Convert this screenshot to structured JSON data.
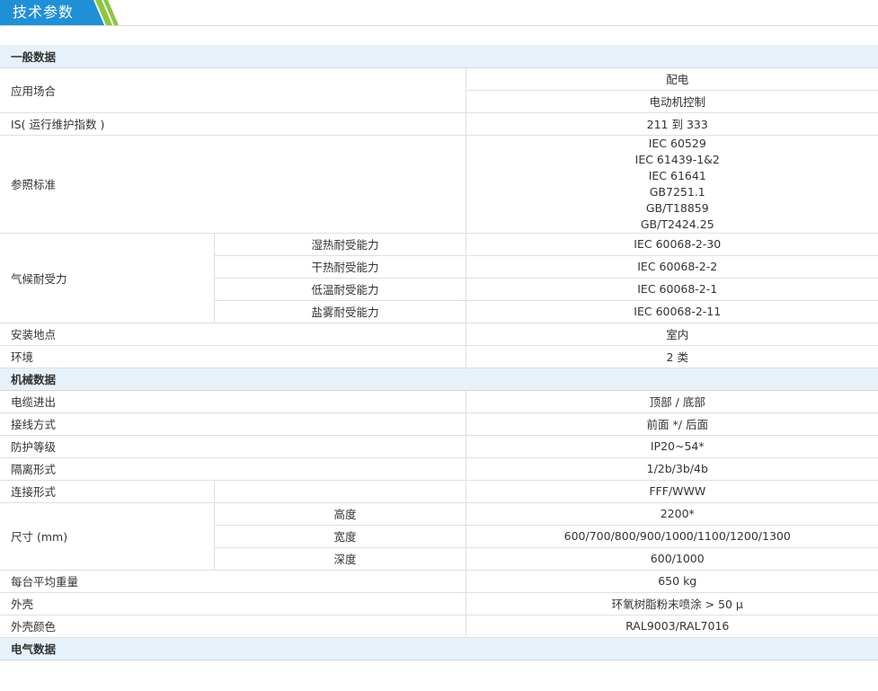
{
  "header": {
    "tab_title": "技术参数",
    "tab_color": "#1f8fd6",
    "stripe_color": "#8dc63f"
  },
  "sections": {
    "general": "一般数据",
    "mechanical": "机械数据",
    "electrical": "电气数据"
  },
  "rows": {
    "application": {
      "label": "应用场合",
      "values": [
        "配电",
        "电动机控制"
      ]
    },
    "is": {
      "label": "IS( 运行维护指数 )",
      "value": "211 到 333"
    },
    "standards": {
      "label": "参照标准",
      "values": [
        "IEC 60529",
        "IEC 61439-1&2",
        "IEC 61641",
        "GB7251.1",
        "GB/T18859",
        "GB/T2424.25"
      ]
    },
    "climate": {
      "label": "气候耐受力",
      "items": [
        {
          "name": "湿热耐受能力",
          "value": "IEC 60068-2-30"
        },
        {
          "name": "干热耐受能力",
          "value": "IEC 60068-2-2"
        },
        {
          "name": "低温耐受能力",
          "value": "IEC 60068-2-1"
        },
        {
          "name": "盐雾耐受能力",
          "value": "IEC 60068-2-11"
        }
      ]
    },
    "location": {
      "label": "安装地点",
      "value": "室内"
    },
    "environment": {
      "label": "环境",
      "value": "2 类"
    },
    "cable": {
      "label": "电缆进出",
      "value": "顶部 / 底部"
    },
    "wiring": {
      "label": "接线方式",
      "value": "前面 */ 后面"
    },
    "protection": {
      "label": "防护等级",
      "value": "IP20~54*"
    },
    "separation": {
      "label": "隔离形式",
      "value": "1/2b/3b/4b"
    },
    "connection": {
      "label": "连接形式",
      "value": "FFF/WWW"
    },
    "dimensions": {
      "label": "尺寸 (mm)",
      "items": [
        {
          "name": "高度",
          "value": "2200*"
        },
        {
          "name": "宽度",
          "value": "600/700/800/900/1000/1100/1200/1300"
        },
        {
          "name": "深度",
          "value": "600/1000"
        }
      ]
    },
    "weight": {
      "label": "每台平均重量",
      "value": "650 kg"
    },
    "enclosure": {
      "label": "外壳",
      "value": "环氧树脂粉末喷涂 > 50 μ"
    },
    "color": {
      "label": "外壳颜色",
      "value": "RAL9003/RAL7016"
    }
  }
}
